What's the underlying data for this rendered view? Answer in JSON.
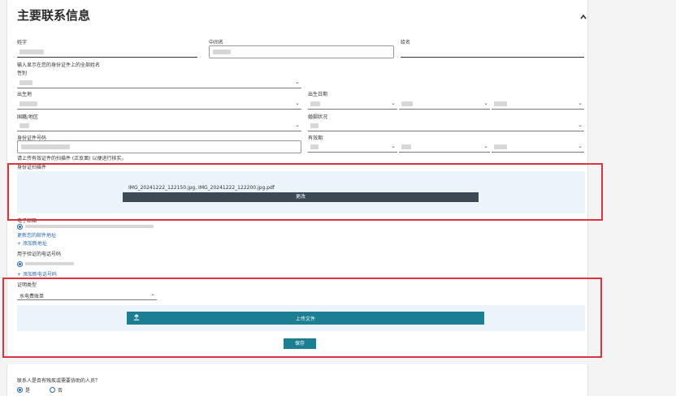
{
  "section": {
    "title": "主要联系信息"
  },
  "fields": {
    "surname_label": "姓字",
    "middle_label": "中间名",
    "given_label": "给名",
    "hint": "输入显示在您的身份证件上的全部姓名",
    "gender_label": "性别",
    "birthplace_label": "出生地",
    "birthdate_label": "出生日期",
    "nationality_label": "国籍/地区",
    "marital_label": "婚姻状况",
    "id_number_label": "身份证件号码",
    "expiry_label": "有效期",
    "upload_hint": "请上传有效证件的扫描件 (正反面) 以便进行核实。",
    "scan_label": "身份证扫描件",
    "uploaded_files": "IMG_20241222_122150.jpg, IMG_20241222_122200.jpg.pdf",
    "change_button": "更改"
  },
  "contact": {
    "address_label": "电子邮箱",
    "add_email_link": "更新您的邮件地址",
    "add_address_link": "+ 添加新地址",
    "phone_label": "用于验证的电话号码",
    "add_phone_link": "+ 添加新电话号码"
  },
  "proof": {
    "type_label": "证明类型",
    "type_value": "水电费账单",
    "upload_button": "上传文件",
    "save_button": "保存"
  },
  "question": {
    "text": "联系人是否有残疾或需要协助的人员？",
    "yes": "是",
    "no": "否"
  }
}
